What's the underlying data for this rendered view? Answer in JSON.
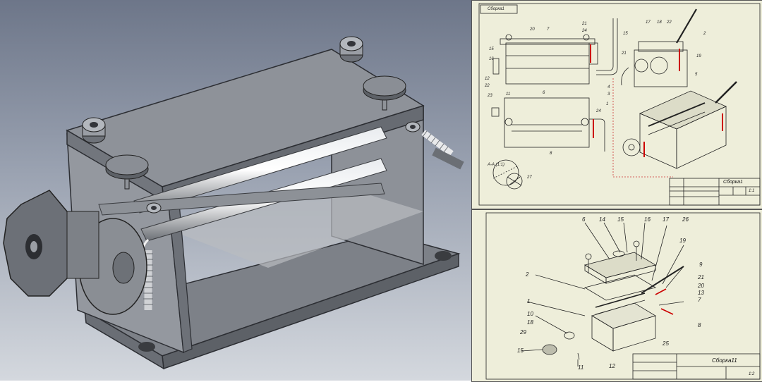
{
  "views": {
    "model_3d": {
      "background_top": "#6d7689",
      "background_bottom": "#d4d8de",
      "body_color": "#8a8e95"
    },
    "drawing_sheet_1": {
      "stamp": "Сборка1",
      "sheet_no": "1:1",
      "title": "Сборка1",
      "section_label": "А-А (1:1)",
      "callouts": [
        "20",
        "7",
        "21",
        "24",
        "15",
        "16",
        "12",
        "22",
        "23",
        "11",
        "6",
        "4",
        "3",
        "1",
        "24",
        "8",
        "27",
        "17",
        "18",
        "22",
        "2",
        "19",
        "15",
        "5",
        "21"
      ]
    },
    "drawing_sheet_2": {
      "title": "Сборка11",
      "sheet_no": "1:2",
      "callouts": [
        "6",
        "14",
        "15",
        "16",
        "17",
        "26",
        "19",
        "9",
        "21",
        "20",
        "13",
        "7",
        "8",
        "25",
        "2",
        "1",
        "10",
        "18",
        "29",
        "15",
        "11",
        "12"
      ]
    }
  }
}
